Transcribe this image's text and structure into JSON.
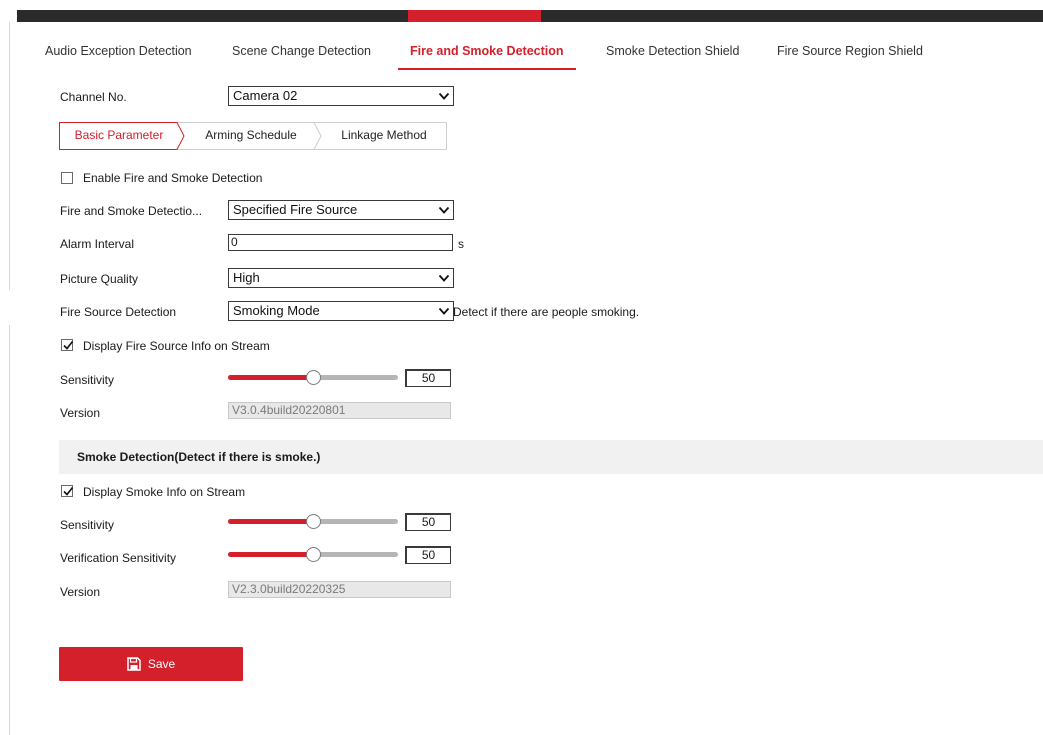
{
  "colors": {
    "accent": "#d4202a",
    "top_bar": "#2b2b2b",
    "section_bg": "#f1f1f1"
  },
  "main_tabs": [
    {
      "label": "Audio Exception Detection",
      "active": false
    },
    {
      "label": "Scene Change Detection",
      "active": false
    },
    {
      "label": "Fire and Smoke Detection",
      "active": true
    },
    {
      "label": "Smoke Detection Shield",
      "active": false
    },
    {
      "label": "Fire Source Region Shield",
      "active": false
    }
  ],
  "channel": {
    "label": "Channel No.",
    "value": "Camera 02"
  },
  "sub_tabs": [
    {
      "label": "Basic Parameter",
      "active": true
    },
    {
      "label": "Arming Schedule",
      "active": false
    },
    {
      "label": "Linkage Method",
      "active": false
    }
  ],
  "enable": {
    "label": "Enable Fire and Smoke Detection",
    "checked": false
  },
  "detection_mode": {
    "label": "Fire and Smoke Detectio...",
    "value": "Specified Fire Source"
  },
  "alarm_interval": {
    "label": "Alarm Interval",
    "value": "0",
    "unit": "s"
  },
  "picture_quality": {
    "label": "Picture Quality",
    "value": "High"
  },
  "fire_source": {
    "label": "Fire Source Detection",
    "value": "Smoking Mode",
    "hint": "Detect if there are people smoking."
  },
  "fire_display": {
    "label": "Display Fire Source Info on Stream",
    "checked": true
  },
  "fire_sensitivity": {
    "label": "Sensitivity",
    "value": "50",
    "level": 0.5
  },
  "fire_version": {
    "label": "Version",
    "value": "V3.0.4build20220801"
  },
  "smoke_section": {
    "title": "Smoke Detection(Detect if there is smoke.)"
  },
  "smoke_display": {
    "label": "Display Smoke Info on Stream",
    "checked": true
  },
  "smoke_sensitivity": {
    "label": "Sensitivity",
    "value": "50",
    "level": 0.5
  },
  "smoke_verification": {
    "label": "Verification Sensitivity",
    "value": "50",
    "level": 0.5
  },
  "smoke_version": {
    "label": "Version",
    "value": "V2.3.0build20220325"
  },
  "save": {
    "label": "Save",
    "icon": "save-icon"
  }
}
